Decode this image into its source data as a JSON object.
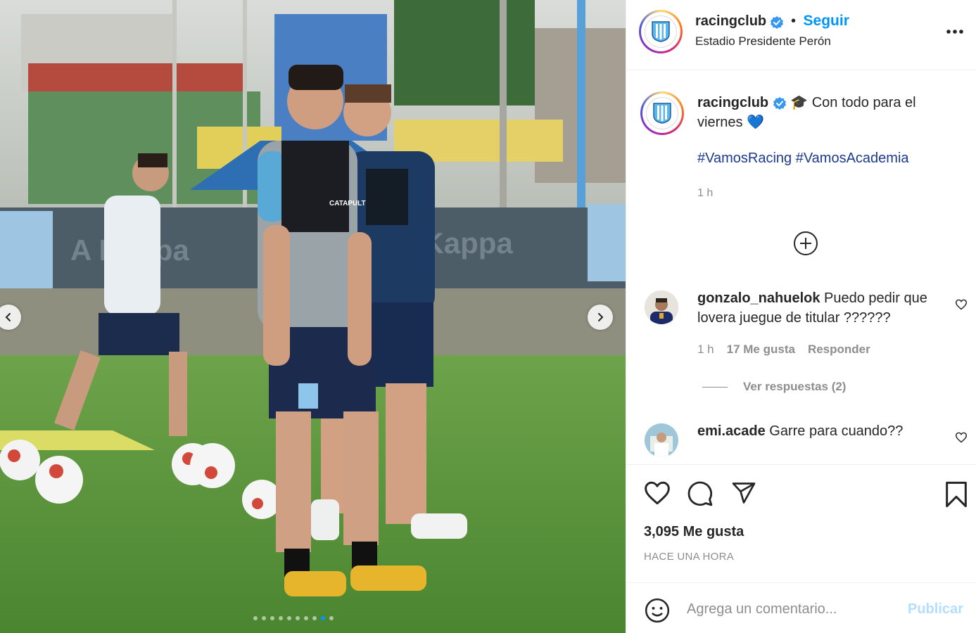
{
  "post": {
    "username": "racingclub",
    "follow_label": "Seguir",
    "location": "Estadio Presidente Perón",
    "more_icon": "more-options-icon"
  },
  "caption": {
    "username": "racingclub",
    "text": "🎓 Con todo para el viernes 💙",
    "hashtag_1": "#VamosRacing",
    "hashtag_2": "#VamosAcademia",
    "time": "1 h"
  },
  "comments": [
    {
      "username": "gonzalo_nahuelok",
      "text": "Puedo pedir que lovera juegue de titular ??????",
      "time": "1 h",
      "likes": "17 Me gusta",
      "reply_label": "Responder",
      "view_replies": "Ver respuestas (2)"
    },
    {
      "username": "emi.acade",
      "text": "Garre para cuando??"
    }
  ],
  "actions": {
    "likes": "3,095 Me gusta",
    "posted": "HACE UNA HORA"
  },
  "composer": {
    "placeholder": "Agrega un comentario...",
    "publish_label": "Publicar"
  },
  "carousel": {
    "total": 10,
    "active_index": 8
  },
  "colors": {
    "accent": "#0095f6",
    "link": "#00376b",
    "muted": "#8e8e8e",
    "publish_disabled": "#b2dffc"
  }
}
